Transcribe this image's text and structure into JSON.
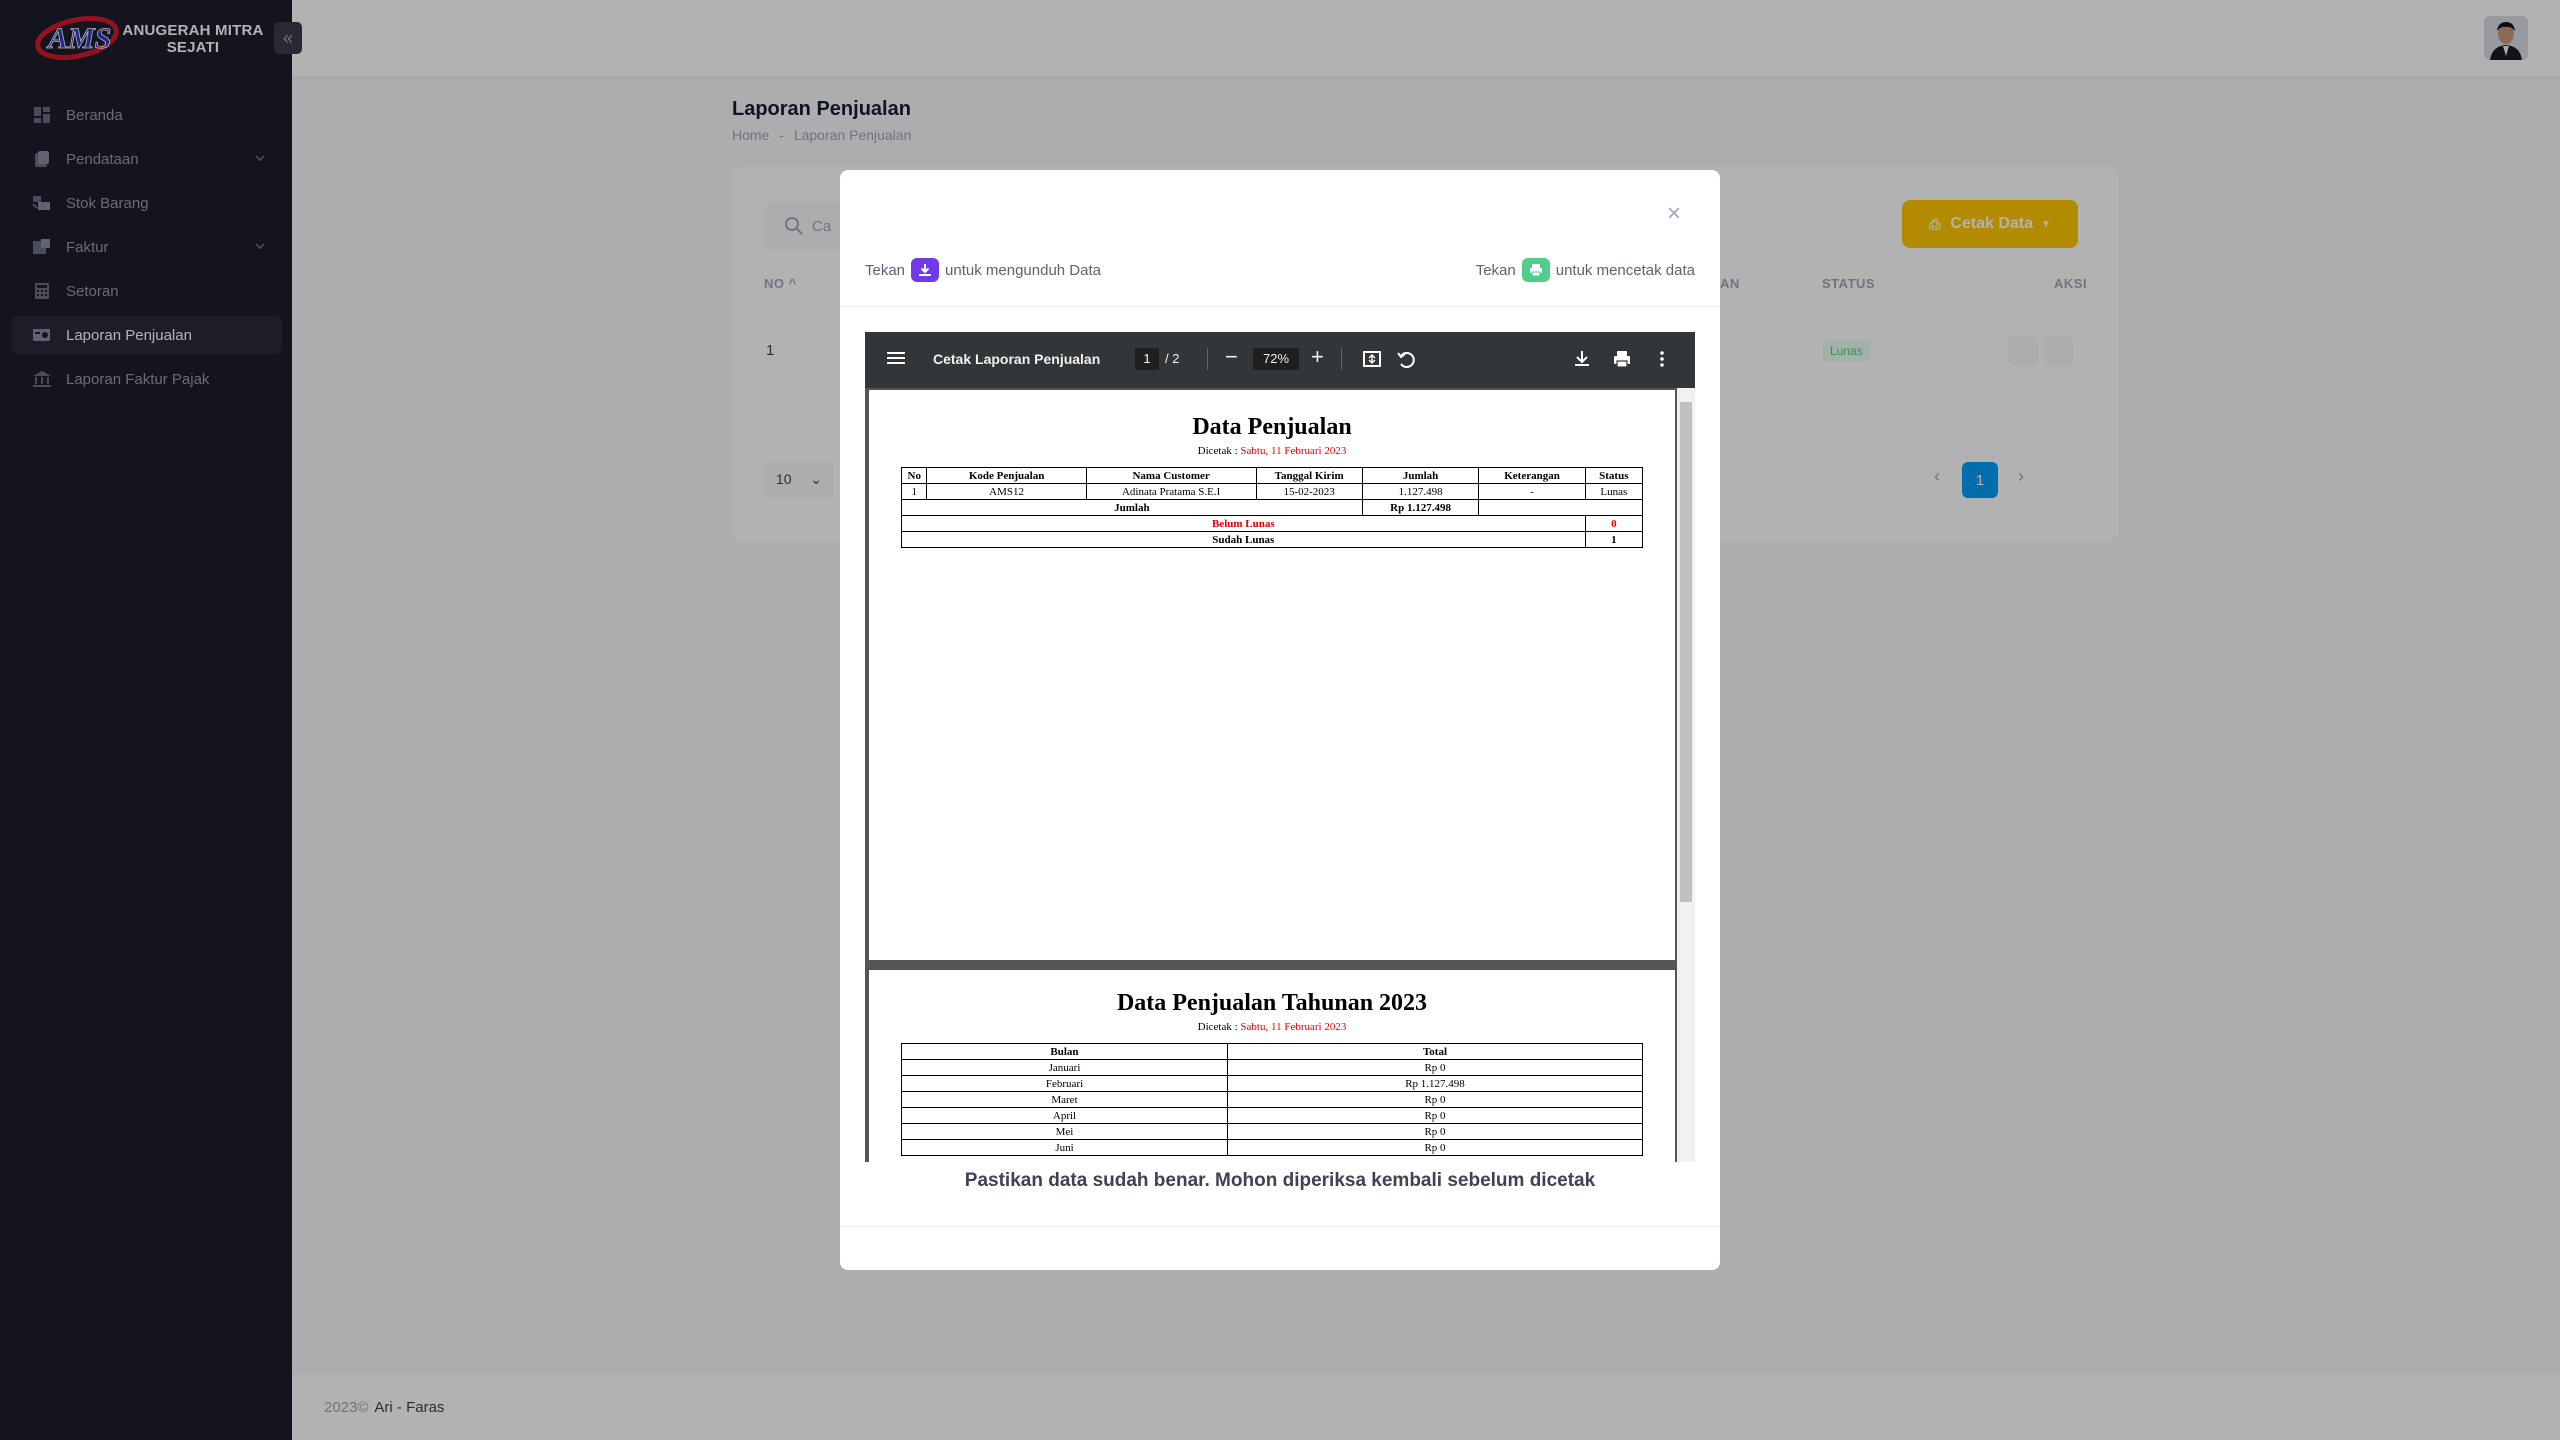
{
  "app": {
    "brand_line1": "ANUGERAH MITRA",
    "brand_line2": "SEJATI",
    "logo_text": "AMS"
  },
  "sidebar": {
    "items": [
      {
        "label": "Beranda",
        "icon": "dashboard-icon"
      },
      {
        "label": "Pendataan",
        "icon": "database-icon",
        "has_chevron": true
      },
      {
        "label": "Stok Barang",
        "icon": "box-icon"
      },
      {
        "label": "Faktur",
        "icon": "invoice-icon",
        "has_chevron": true
      },
      {
        "label": "Setoran",
        "icon": "calculator-icon"
      },
      {
        "label": "Laporan Penjualan",
        "icon": "report-icon",
        "active": true
      },
      {
        "label": "Laporan Faktur Pajak",
        "icon": "bank-icon"
      }
    ]
  },
  "page": {
    "title": "Laporan Penjualan",
    "breadcrumb": [
      "Home",
      "-",
      "Laporan Penjualan"
    ]
  },
  "card": {
    "search_placeholder": "Ca",
    "cetak_button": "Cetak Data",
    "columns": {
      "no": "NO",
      "partial": "AN",
      "status": "STATUS",
      "aksi": "AKSI"
    },
    "row": {
      "no": "1",
      "status": "Lunas"
    },
    "per_page": "10",
    "current_page": "1"
  },
  "modal": {
    "hint_left_prefix": "Tekan",
    "hint_left_suffix": "untuk mengunduh Data",
    "hint_right_prefix": "Tekan",
    "hint_right_suffix": "untuk mencetak data",
    "caption": "Pastikan data sudah benar. Mohon diperiksa kembali sebelum dicetak"
  },
  "pdf": {
    "title": "Cetak Laporan Penjualan",
    "page_current": "1",
    "page_total": "/  2",
    "zoom": "72%",
    "page1": {
      "title": "Data Penjualan",
      "dicetak_label": "Dicetak : ",
      "dicetak_date": "Sabtu, 11 Februari 2023",
      "headers": [
        "No",
        "Kode Penjualan",
        "Nama Customer",
        "Tanggal Kirim",
        "Jumlah",
        "Keterangan",
        "Status"
      ],
      "row": [
        "1",
        "AMS12",
        "Adinata Pratama S.E.I",
        "15-02-2023",
        "1.127.498",
        "-",
        "Lunas"
      ],
      "total_label": "Jumlah",
      "total_value": "Rp 1.127.498",
      "belum_label": "Belum Lunas",
      "belum_value": "0",
      "sudah_label": "Sudah Lunas",
      "sudah_value": "1"
    },
    "page2": {
      "title": "Data Penjualan Tahunan 2023",
      "dicetak_label": "Dicetak : ",
      "dicetak_date": "Sabtu, 11 Februari 2023",
      "headers": [
        "Bulan",
        "Total"
      ],
      "rows": [
        [
          "Januari",
          "Rp 0"
        ],
        [
          "Februari",
          "Rp 1.127.498"
        ],
        [
          "Maret",
          "Rp 0"
        ],
        [
          "April",
          "Rp 0"
        ],
        [
          "Mei",
          "Rp 0"
        ],
        [
          "Juni",
          "Rp 0"
        ]
      ]
    }
  },
  "footer": {
    "year": "2023©",
    "author": "Ari - Faras"
  },
  "colors": {
    "sidebar": "#1e1e2d",
    "accent_yellow": "#ffc700",
    "accent_blue": "#009ef7",
    "download_purple": "#7239ea",
    "print_green": "#50cd89"
  }
}
